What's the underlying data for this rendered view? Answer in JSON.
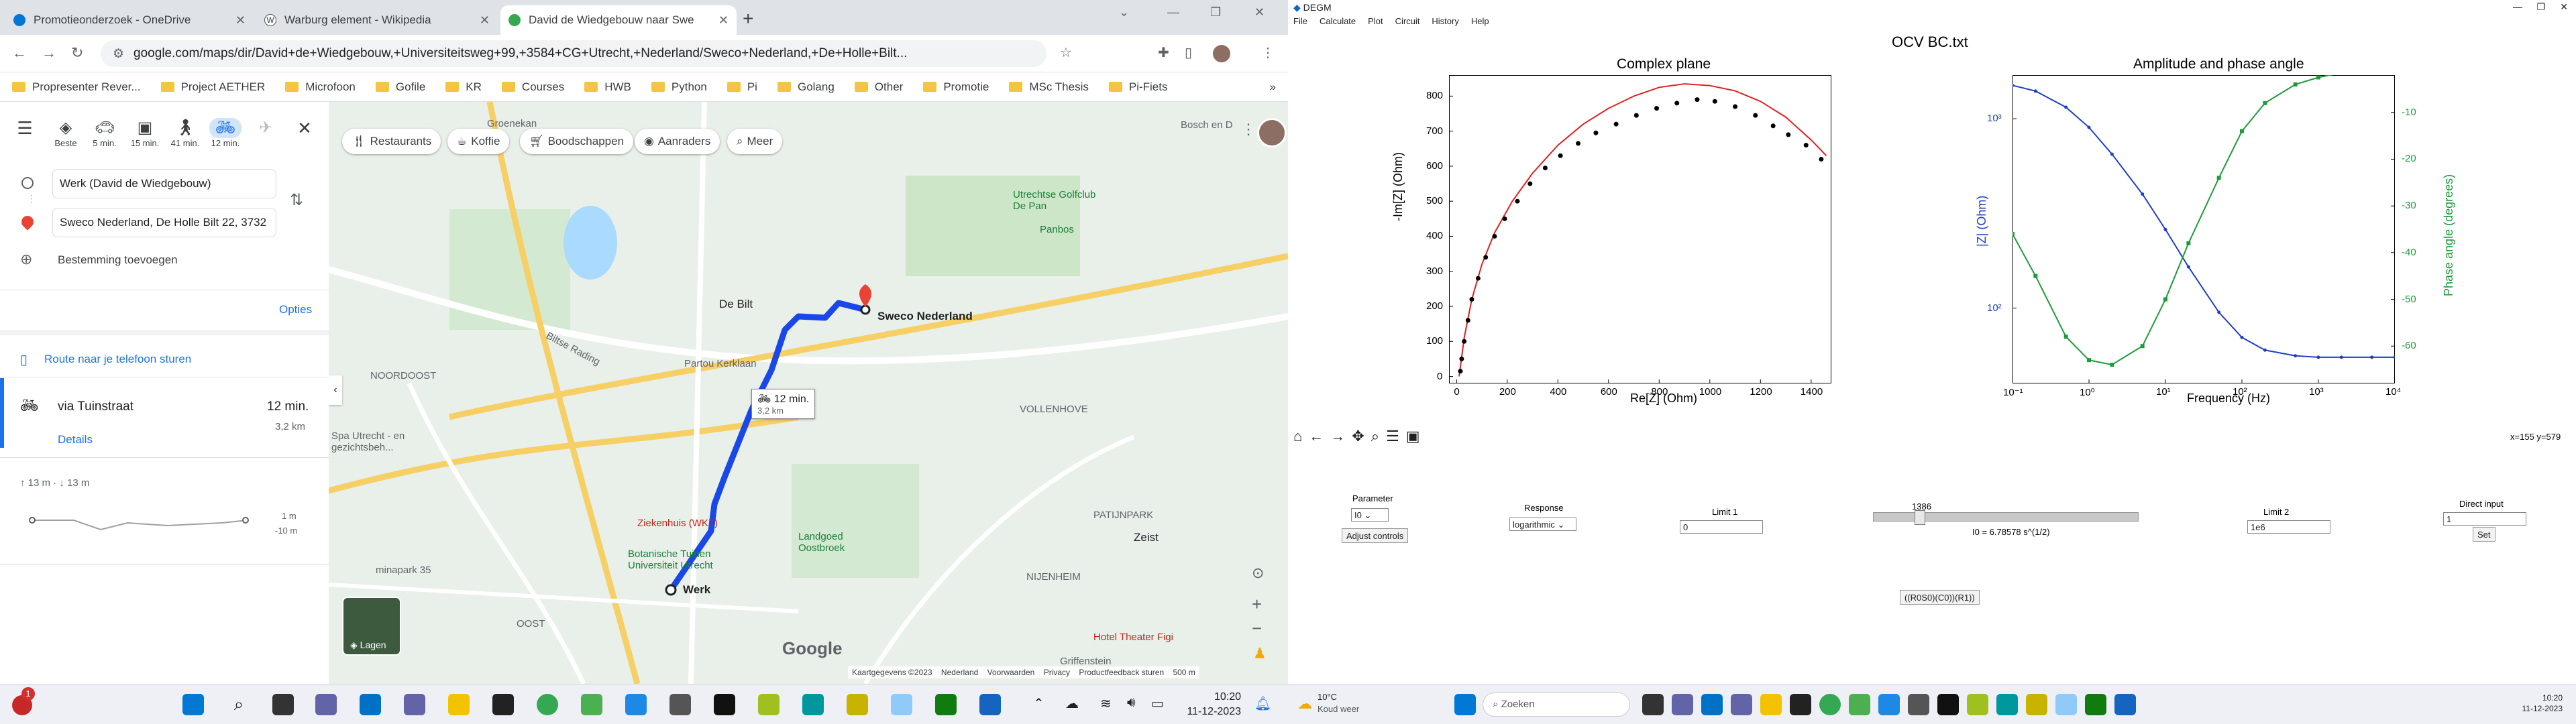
{
  "left_screen": {
    "tabs": [
      {
        "label": "Promotieonderzoek - OneDrive",
        "color": "#0078d4"
      },
      {
        "label": "Warburg element - Wikipedia",
        "color": "#000000"
      },
      {
        "label": "David de Wiedgebouw naar Swe",
        "color": "#34a853"
      }
    ],
    "address": "google.com/maps/dir/David+de+Wiedgebouw,+Universiteitsweg+99,+3584+CG+Utrecht,+Nederland/Sweco+Nederland,+De+Holle+Bilt...",
    "bookmarks": [
      "Propresenter Rever...",
      "Project AETHER",
      "Microfoon",
      "Gofile",
      "KR",
      "Courses",
      "HWB",
      "Python",
      "Pi",
      "Golang",
      "Other",
      "Promotie",
      "MSc Thesis",
      "Pi-Fiets"
    ],
    "modes": [
      {
        "label": "Beste",
        "icon": "diamond-icon"
      },
      {
        "label": "5 min.",
        "icon": "car-icon"
      },
      {
        "label": "15 min.",
        "icon": "train-icon"
      },
      {
        "label": "41 min.",
        "icon": "walk-icon"
      },
      {
        "label": "12 min.",
        "icon": "bike-icon"
      },
      {
        "label": "",
        "icon": "plane-icon"
      }
    ],
    "origin": "Werk (David de Wiedgebouw)",
    "destination": "Sweco Nederland, De Holle Bilt 22, 3732",
    "add_destination": "Bestemming toevoegen",
    "options": "Opties",
    "send_to_phone": "Route naar je telefoon sturen",
    "route": {
      "name": "via Tuinstraat",
      "time": "12 min.",
      "distance": "3,2 km",
      "details": "Details"
    },
    "elevation": {
      "summary": "↑ 13 m · ↓ 13 m",
      "top": "1 m",
      "bottom": "-10 m"
    },
    "chips": [
      "Restaurants",
      "Koffie",
      "Boodschappen",
      "Aanraders",
      "Meer"
    ],
    "map_labels": {
      "dest": "Sweco Nederland",
      "start": "Werk",
      "route_time": "12 min.",
      "route_dist": "3,2 km",
      "debilt": "De Bilt",
      "noordoost": "NOORDOOST",
      "vollenhove": "VOLLENHOVE",
      "zeist": "Zeist",
      "nijenheim": "NIJENHEIM",
      "oost": "OOST",
      "patijnpark": "PATIJNPARK",
      "golf": "Utrechtse Golfclub De Pan",
      "panbos": "Panbos",
      "partou": "Partou Kerklaan",
      "landgoed": "Landgoed Oostbroek",
      "hotel": "Hotel Theater Figi",
      "hospital": "Ziekenhuis (WKZ)",
      "botanic": "Botanische Tuinen Universiteit Utrecht",
      "spa": "Spa Utrecht - en gezichtsbeh...",
      "griffenstein": "Griffenstein",
      "groenekan": "Groenekan",
      "bosch": "Bosch en D",
      "weg": "Biltse Rading",
      "layers": "Lagen",
      "minapark": "minapark 35",
      "footer": "Kaartgegevens ©2023    Nederland    Voorwaarden    Privacy    Productfeedback sturen    500 m"
    },
    "google": "Google",
    "clock": {
      "time": "10:20",
      "date": "11-12-2023"
    },
    "notif_badge": "1"
  },
  "right_screen": {
    "window_title": "DEGM",
    "menu": [
      "File",
      "Calculate",
      "Plot",
      "Circuit",
      "History",
      "Help"
    ],
    "file_title": "OCV BC.txt",
    "plot1": {
      "title": "Complex plane",
      "xlabel": "Re[Z] (Ohm)",
      "ylabel": "-Im[Z] (Ohm)",
      "xticks": [
        "0",
        "200",
        "400",
        "600",
        "800",
        "1000",
        "1200",
        "1400"
      ],
      "yticks": [
        "0",
        "100",
        "200",
        "300",
        "400",
        "500",
        "600",
        "700",
        "800"
      ]
    },
    "plot2": {
      "title": "Amplitude and phase angle",
      "xlabel": "Frequency (Hz)",
      "ylabel_left": "|Z| (Ohm)",
      "ylabel_right": "Phase angle (degrees)",
      "xticks": [
        "10⁻¹",
        "10⁰",
        "10¹",
        "10²",
        "10³",
        "10⁴"
      ],
      "yticks_left": [
        "10³",
        "10²"
      ],
      "yticks_right": [
        "-10",
        "-20",
        "-30",
        "-40",
        "-50",
        "-60"
      ]
    },
    "coords": "x=155  y=579",
    "controls": {
      "parameter_label": "Parameter",
      "parameter_value": "I0",
      "adjust": "Adjust controls",
      "response_label": "Response",
      "response_value": "logarithmic",
      "limit1_label": "Limit 1",
      "limit1_value": "0",
      "slider_value": "1386",
      "slider_fraction": 0.16,
      "formula": "I0 = 6.78578  s^(1/2)",
      "limit2_label": "Limit 2",
      "limit2_value": "1e6",
      "direct_label": "Direct input",
      "direct_value": "1",
      "set": "Set",
      "circuit": "((R0S0)(C0))(R1))"
    },
    "weather": {
      "temp": "10°C",
      "desc": "Koud weer"
    },
    "search": "Zoeken",
    "clock": {
      "time": "10:20",
      "date": "11-12-2023"
    }
  },
  "chart_data": [
    {
      "type": "scatter",
      "title": "Complex plane",
      "xlabel": "Re[Z] (Ohm)",
      "ylabel": "-Im[Z] (Ohm)",
      "xlim": [
        -30,
        1480
      ],
      "ylim": [
        -20,
        860
      ],
      "series": [
        {
          "name": "",
          "kind": "points",
          "color": "#000000",
          "x": [
            15,
            20,
            30,
            45,
            60,
            85,
            115,
            150,
            190,
            240,
            290,
            350,
            410,
            480,
            550,
            630,
            710,
            790,
            870,
            950,
            1020,
            1100,
            1180,
            1250,
            1310,
            1380,
            1440
          ],
          "y": [
            15,
            50,
            100,
            160,
            220,
            280,
            340,
            400,
            450,
            500,
            550,
            595,
            630,
            665,
            695,
            720,
            745,
            765,
            780,
            790,
            785,
            770,
            745,
            715,
            690,
            660,
            620
          ]
        },
        {
          "name": "",
          "kind": "line",
          "color": "#e02020",
          "x": [
            10,
            30,
            60,
            100,
            150,
            220,
            300,
            400,
            500,
            600,
            700,
            800,
            900,
            1000,
            1100,
            1200,
            1300,
            1400,
            1460
          ],
          "y": [
            0,
            110,
            220,
            320,
            410,
            500,
            580,
            660,
            720,
            765,
            800,
            825,
            835,
            830,
            815,
            785,
            740,
            675,
            630
          ]
        }
      ]
    },
    {
      "type": "line",
      "title": "Amplitude and phase angle",
      "xlabel": "Frequency (Hz)",
      "ylabel": "|Z| (Ohm)",
      "ylabel_right": "Phase angle (degrees)",
      "xscale": "log",
      "xlim": [
        0.1,
        10000
      ],
      "series": [
        {
          "name": "",
          "axis": "left",
          "color": "#1f3fbf",
          "x": [
            0.1,
            0.2,
            0.5,
            1,
            2,
            5,
            10,
            20,
            50,
            100,
            200,
            500,
            1000,
            2000,
            5000,
            10000
          ],
          "y": [
            1500,
            1400,
            1150,
            900,
            650,
            400,
            260,
            165,
            95,
            70,
            60,
            56,
            55,
            55,
            55,
            55
          ]
        },
        {
          "name": "",
          "axis": "right",
          "color": "#1f9a3a",
          "x": [
            0.1,
            0.2,
            0.5,
            1,
            2,
            5,
            10,
            20,
            50,
            100,
            200,
            500,
            1000,
            2000,
            5000,
            10000
          ],
          "y": [
            -36,
            -45,
            -58,
            -63,
            -64,
            -60,
            -50,
            -38,
            -24,
            -14,
            -8,
            -4,
            -2.5,
            -1.5,
            -1,
            -1
          ]
        }
      ],
      "ylim_left": [
        40,
        1700
      ],
      "ylim_right": [
        -68,
        -2
      ]
    }
  ]
}
